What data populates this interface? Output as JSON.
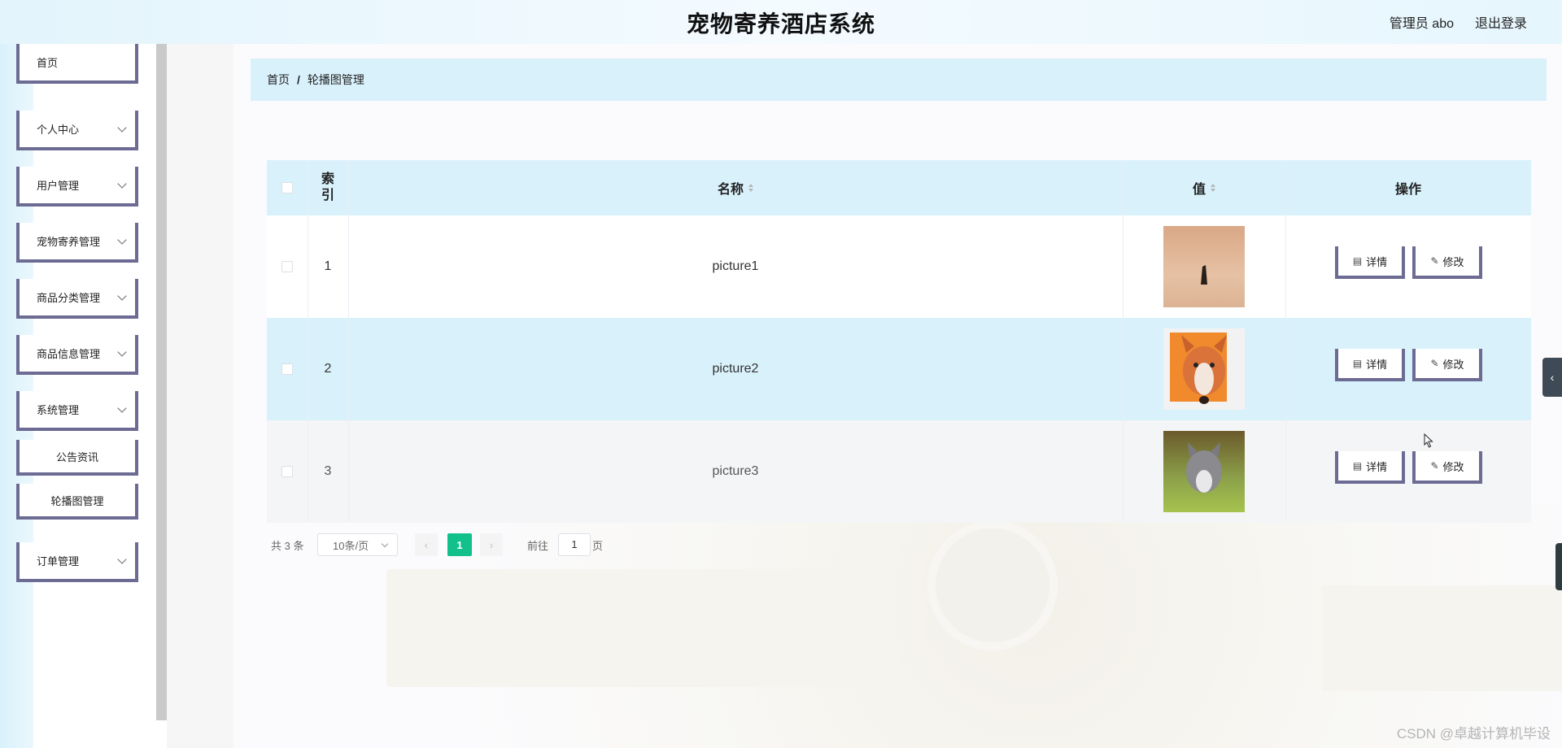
{
  "header": {
    "title": "宠物寄养酒店系统",
    "user": "管理员 abo",
    "logout": "退出登录"
  },
  "sidebar": {
    "items": [
      {
        "label": "首页",
        "has_children": false
      },
      {
        "label": "个人中心",
        "has_children": true
      },
      {
        "label": "用户管理",
        "has_children": true
      },
      {
        "label": "宠物寄养管理",
        "has_children": true
      },
      {
        "label": "商品分类管理",
        "has_children": true
      },
      {
        "label": "商品信息管理",
        "has_children": true
      },
      {
        "label": "系统管理",
        "has_children": true
      }
    ],
    "subitems": [
      "公告资讯",
      "轮播图管理"
    ],
    "last": {
      "label": "订单管理",
      "has_children": true
    }
  },
  "breadcrumb": {
    "home": "首页",
    "sep": "/",
    "current": "轮播图管理"
  },
  "table": {
    "headers": {
      "index": "索\n引",
      "name": "名称",
      "value": "值",
      "action": "操作"
    },
    "rows": [
      {
        "index": "1",
        "name": "picture1"
      },
      {
        "index": "2",
        "name": "picture2"
      },
      {
        "index": "3",
        "name": "picture3"
      }
    ],
    "actions": {
      "detail": "详情",
      "edit": "修改"
    }
  },
  "pagination": {
    "total": "共 3 条",
    "page_size": "10条/页",
    "current": "1",
    "goto_label": "前往",
    "goto_value": "1",
    "page_unit": "页"
  },
  "watermark": "CSDN @卓越计算机毕设",
  "colors": {
    "header_bg": "#e3f4fc",
    "accent_light": "#d9f1fb",
    "menu_border": "#6c6b93",
    "pager_active": "#12c08c"
  },
  "icons": [
    "chevron-down-icon",
    "document-icon",
    "edit-pen-icon",
    "chevron-left-icon",
    "chevron-right-icon",
    "sort-icon"
  ]
}
